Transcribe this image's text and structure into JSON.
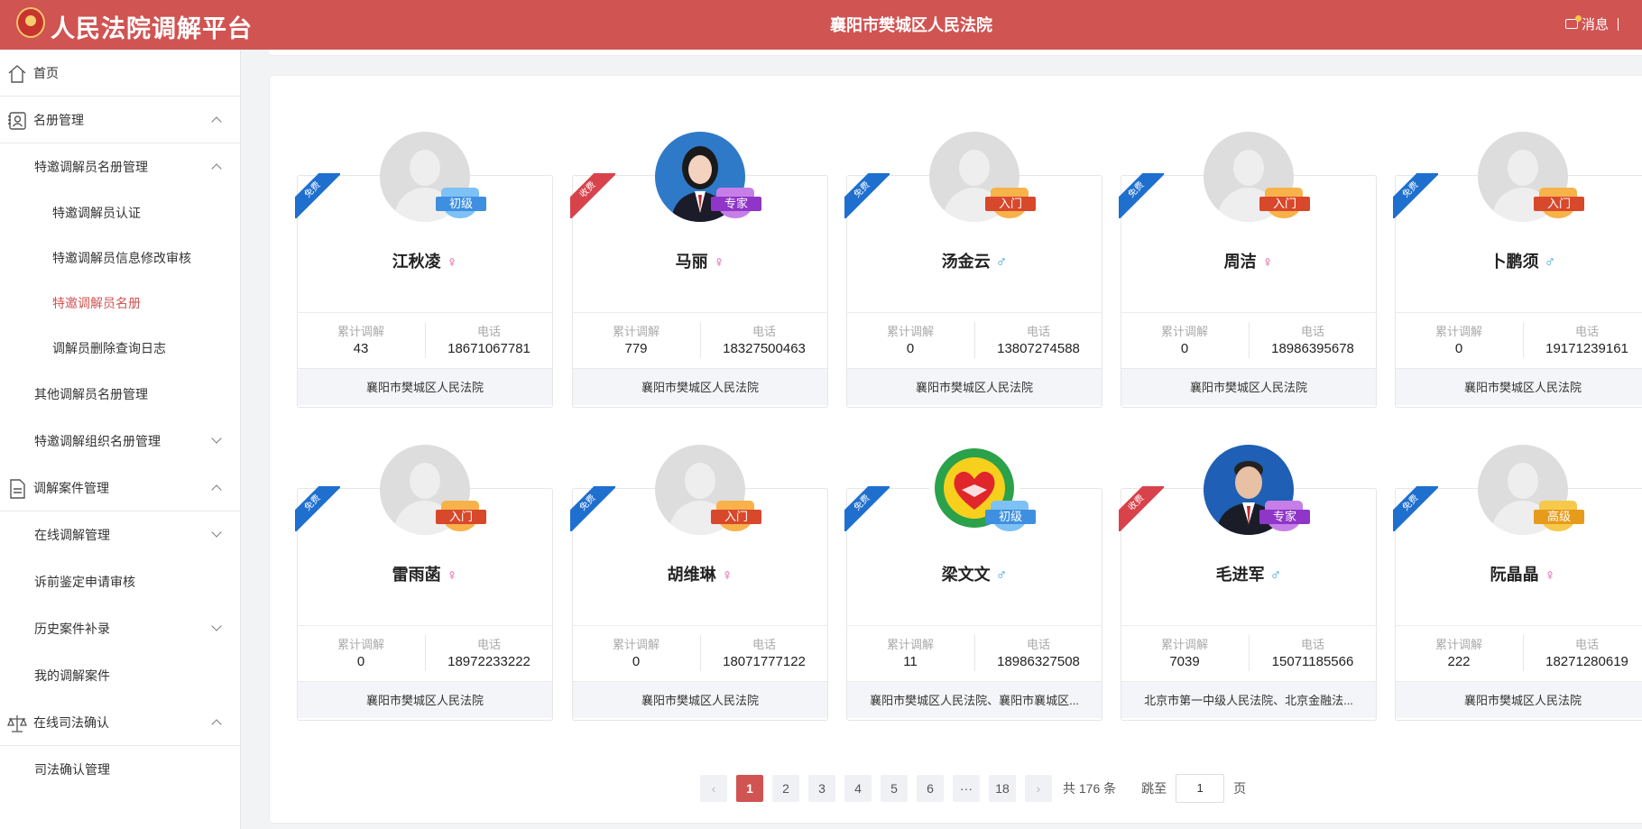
{
  "header": {
    "app_title": "人民法院调解平台",
    "court_title": "襄阳市樊城区人民法院",
    "message_label": "消息"
  },
  "colors": {
    "brand": "#d05452",
    "free": "#1f6fcf",
    "paid": "#d8434b"
  },
  "sidebar": {
    "items": [
      {
        "label": "首页",
        "level": "top",
        "icon": "home-icon"
      },
      {
        "label": "名册管理",
        "level": "top",
        "icon": "roster-icon",
        "chevron": "up"
      },
      {
        "label": "特邀调解员名册管理",
        "level": "sub",
        "chevron": "up"
      },
      {
        "label": "特邀调解员认证",
        "level": "sub2"
      },
      {
        "label": "特邀调解员信息修改审核",
        "level": "sub2"
      },
      {
        "label": "特邀调解员名册",
        "level": "sub2",
        "active": true
      },
      {
        "label": "调解员删除查询日志",
        "level": "sub2"
      },
      {
        "label": "其他调解员名册管理",
        "level": "sub"
      },
      {
        "label": "特邀调解组织名册管理",
        "level": "sub",
        "chevron": "down"
      },
      {
        "label": "调解案件管理",
        "level": "top",
        "icon": "document-icon",
        "chevron": "up"
      },
      {
        "label": "在线调解管理",
        "level": "sub",
        "chevron": "down"
      },
      {
        "label": "诉前鉴定申请审核",
        "level": "sub"
      },
      {
        "label": "历史案件补录",
        "level": "sub",
        "chevron": "down"
      },
      {
        "label": "我的调解案件",
        "level": "sub"
      },
      {
        "label": "在线司法确认",
        "level": "top",
        "icon": "scale-icon",
        "chevron": "up"
      },
      {
        "label": "司法确认管理",
        "level": "sub"
      }
    ]
  },
  "cards": [
    {
      "name": "江秋凌",
      "gender": "♀",
      "fee": "免费",
      "level": "初级",
      "level_color": "blue",
      "mediations_label": "累计调解",
      "mediations": "43",
      "phone_label": "电话",
      "phone": "18671067781",
      "court": "襄阳市樊城区人民法院",
      "avatar": "default"
    },
    {
      "name": "马丽",
      "gender": "♀",
      "fee": "收费",
      "level": "专家",
      "level_color": "purple",
      "mediations_label": "累计调解",
      "mediations": "779",
      "phone_label": "电话",
      "phone": "18327500463",
      "court": "襄阳市樊城区人民法院",
      "avatar": "photo-woman"
    },
    {
      "name": "汤金云",
      "gender": "♂",
      "fee": "免费",
      "level": "入门",
      "level_color": "orange",
      "mediations_label": "累计调解",
      "mediations": "0",
      "phone_label": "电话",
      "phone": "13807274588",
      "court": "襄阳市樊城区人民法院",
      "avatar": "default"
    },
    {
      "name": "周洁",
      "gender": "♀",
      "fee": "免费",
      "level": "入门",
      "level_color": "orange",
      "mediations_label": "累计调解",
      "mediations": "0",
      "phone_label": "电话",
      "phone": "18986395678",
      "court": "襄阳市樊城区人民法院",
      "avatar": "default"
    },
    {
      "name": "卜鹏须",
      "gender": "♂",
      "fee": "免费",
      "level": "入门",
      "level_color": "orange",
      "mediations_label": "累计调解",
      "mediations": "0",
      "phone_label": "电话",
      "phone": "19171239161",
      "court": "襄阳市樊城区人民法院",
      "avatar": "default"
    },
    {
      "name": "雷雨菡",
      "gender": "♀",
      "fee": "免费",
      "level": "入门",
      "level_color": "orange",
      "mediations_label": "累计调解",
      "mediations": "0",
      "phone_label": "电话",
      "phone": "18972233222",
      "court": "襄阳市樊城区人民法院",
      "avatar": "default"
    },
    {
      "name": "胡维琳",
      "gender": "♀",
      "fee": "免费",
      "level": "入门",
      "level_color": "orange",
      "mediations_label": "累计调解",
      "mediations": "0",
      "phone_label": "电话",
      "phone": "18071777122",
      "court": "襄阳市樊城区人民法院",
      "avatar": "default"
    },
    {
      "name": "梁文文",
      "gender": "♂",
      "fee": "免费",
      "level": "初级",
      "level_color": "blue",
      "mediations_label": "累计调解",
      "mediations": "11",
      "phone_label": "电话",
      "phone": "18986327508",
      "court": "襄阳市樊城区人民法院、襄阳市襄城区...",
      "avatar": "logo-handshake"
    },
    {
      "name": "毛进军",
      "gender": "♂",
      "fee": "收费",
      "level": "专家",
      "level_color": "purple",
      "mediations_label": "累计调解",
      "mediations": "7039",
      "phone_label": "电话",
      "phone": "15071185566",
      "court": "北京市第一中级人民法院、北京金融法...",
      "avatar": "photo-man"
    },
    {
      "name": "阮晶晶",
      "gender": "♀",
      "fee": "免费",
      "level": "高级",
      "level_color": "gold",
      "mediations_label": "累计调解",
      "mediations": "222",
      "phone_label": "电话",
      "phone": "18271280619",
      "court": "襄阳市樊城区人民法院",
      "avatar": "default"
    }
  ],
  "pagination": {
    "prev": "‹",
    "pages": [
      "1",
      "2",
      "3",
      "4",
      "5",
      "6",
      "···",
      "18"
    ],
    "current": "1",
    "next": "›",
    "total": "共 176 条",
    "jump_label": "跳至",
    "jump_value": "1",
    "page_suffix": "页"
  }
}
